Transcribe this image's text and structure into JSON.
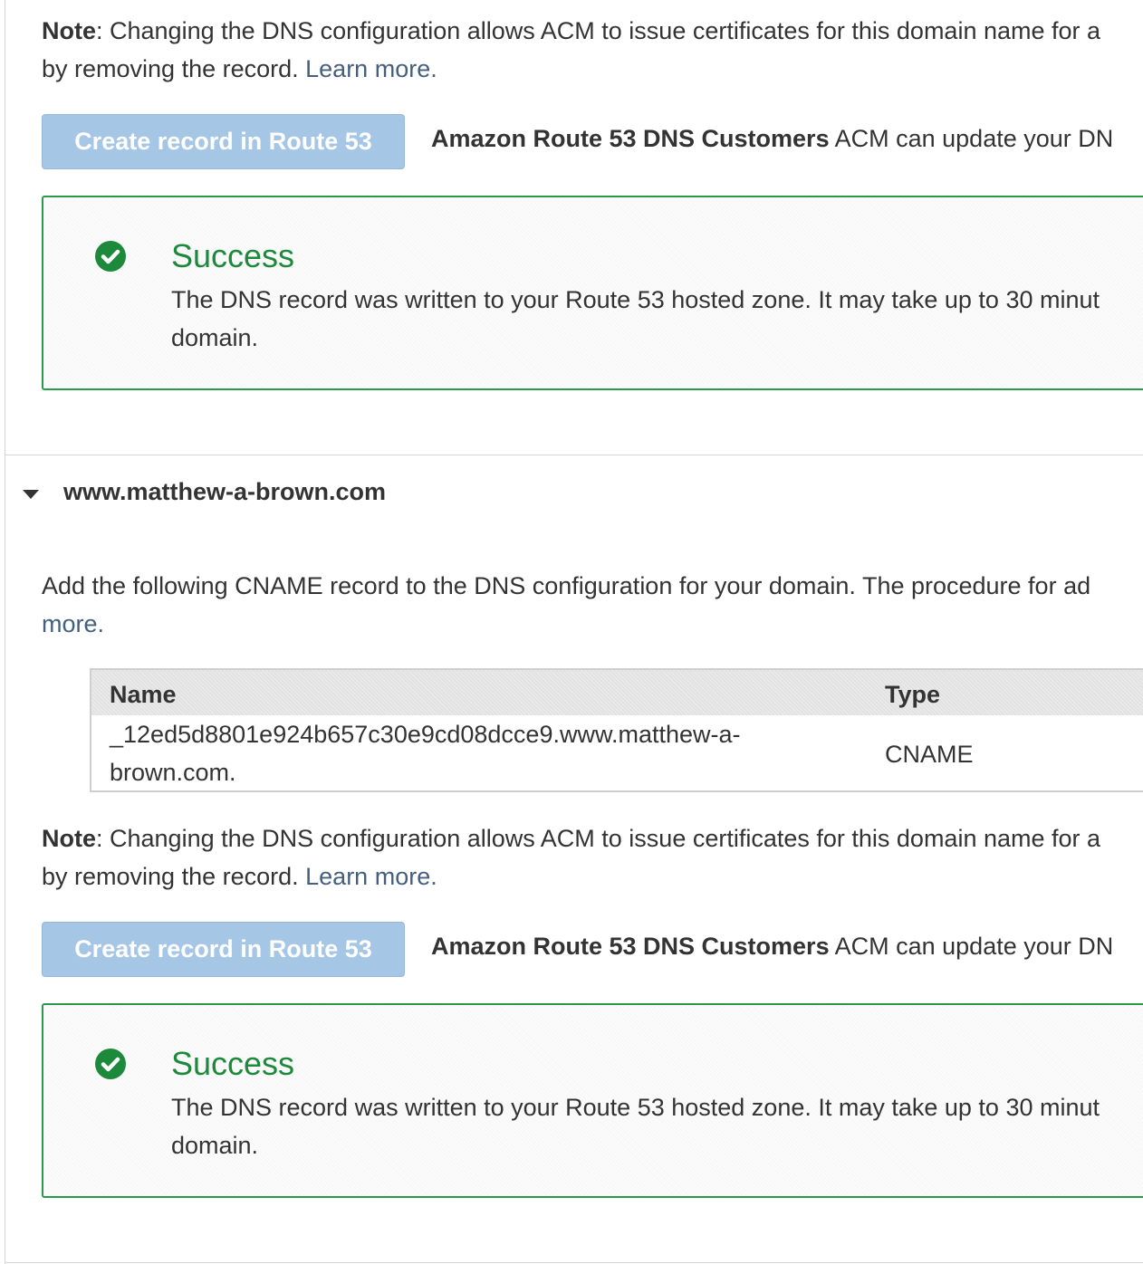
{
  "section1": {
    "note": {
      "label": "Note",
      "line1": ": Changing the DNS configuration allows ACM to issue certificates for this domain name for a",
      "line2": "by removing the record. ",
      "link": "Learn more."
    },
    "create_button": "Create record in Route 53",
    "customers_bold": "Amazon Route 53 DNS Customers",
    "customers_text": " ACM can update your DN",
    "success": {
      "title": "Success",
      "line1": "The DNS record was written to your Route 53 hosted zone. It may take up to 30 minut",
      "line2": "domain."
    }
  },
  "section2": {
    "domain": "www.matthew-a-brown.com",
    "intro_line1": "Add the following CNAME record to the DNS configuration for your domain. The procedure for ad",
    "intro_link": "more.",
    "table": {
      "headers": {
        "name": "Name",
        "type": "Type"
      },
      "row": {
        "name_line1": "_12ed5d8801e924b657c30e9cd08dcce9.www.matthew-a-",
        "name_line2": "brown.com.",
        "type": "CNAME"
      }
    },
    "note": {
      "label": "Note",
      "line1": ": Changing the DNS configuration allows ACM to issue certificates for this domain name for a",
      "line2": "by removing the record. ",
      "link": "Learn more."
    },
    "create_button": "Create record in Route 53",
    "customers_bold": "Amazon Route 53 DNS Customers",
    "customers_text": " ACM can update your DN",
    "success": {
      "title": "Success",
      "line1": "The DNS record was written to your Route 53 hosted zone. It may take up to 30 minut",
      "line2": "domain."
    }
  },
  "icons": {
    "success": "check-circle-icon",
    "expand": "caret-down-icon"
  },
  "colors": {
    "success_green": "#1d8a3b",
    "button_disabled": "#a6c6e6",
    "link": "#44607e"
  }
}
